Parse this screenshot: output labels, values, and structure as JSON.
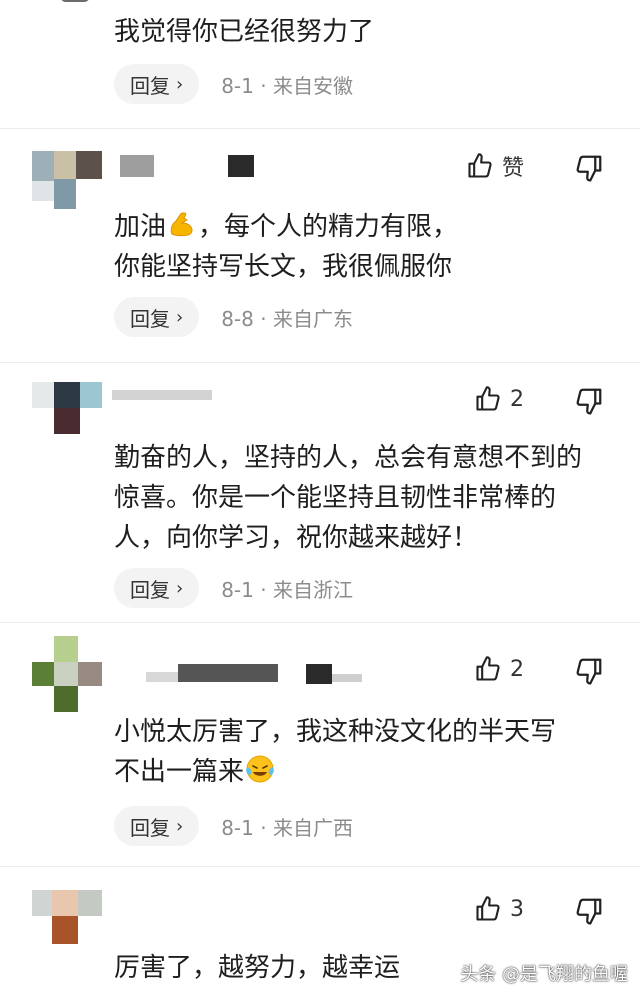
{
  "reply_label": "回复",
  "like_label": "赞",
  "colors": {
    "meta": "#8c8c8c",
    "reply_bg": "#f3f3f3",
    "text": "#1e1e1e"
  },
  "comments": [
    {
      "text": "我觉得你已经很努力了",
      "date": "8-1",
      "sep": "·",
      "location": "来自安徽"
    },
    {
      "text_before_emoji": "加油",
      "emoji": "flexed-biceps-emoji",
      "text_after_emoji": "，每个人的精力有限，\n你能坚持写长文，我很佩服你",
      "date": "8-8",
      "sep": "·",
      "location": "来自广东",
      "likes": "赞"
    },
    {
      "text": "勤奋的人，坚持的人，总会有意想不到的惊喜。你是一个能坚持且韧性非常棒的人，向你学习，祝你越来越好！",
      "date": "8-1",
      "sep": "·",
      "location": "来自浙江",
      "likes": "2"
    },
    {
      "text_before_emoji": "小悦太厉害了，我这种没文化的半天写\n不出一篇来",
      "emoji": "crying-laughing-emoji",
      "date": "8-1",
      "sep": "·",
      "location": "来自广西",
      "likes": "2"
    },
    {
      "text": "厉害了，越努力，越幸运",
      "likes": "3"
    }
  ],
  "watermark": "头条 @是飞翔的鱼喔"
}
